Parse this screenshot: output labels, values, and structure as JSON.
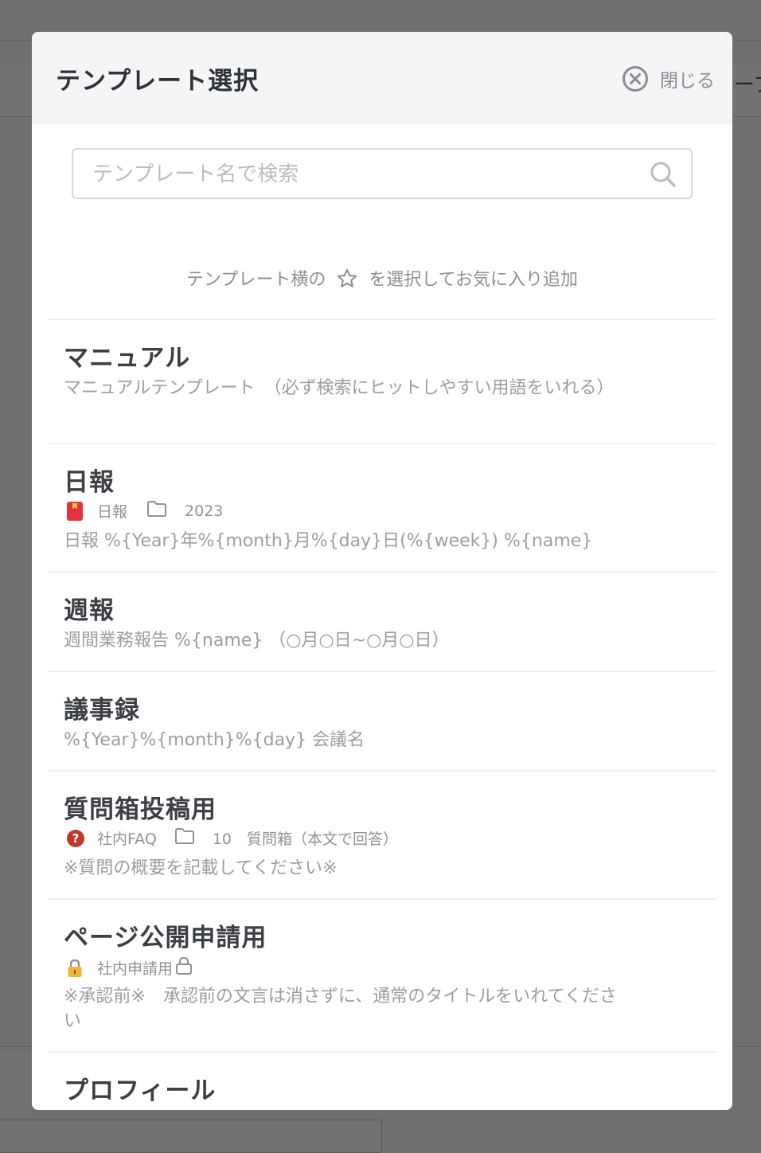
{
  "background": {
    "right_edge_text": "ーブ"
  },
  "modal": {
    "title": "テンプレート選択",
    "close_label": "閉じる",
    "search_placeholder": "テンプレート名で検索",
    "hint_before": "テンプレート横の",
    "hint_after": "を選択してお気に入り追加"
  },
  "templates": [
    {
      "title": "マニュアル",
      "description": "マニュアルテンプレート　（必ず検索にヒットしやすい用語をいれる）"
    },
    {
      "title": "日報",
      "category": "日報",
      "folder": "2023",
      "description": "日報 %{Year}年%{month}月%{day}日(%{week}) %{name}"
    },
    {
      "title": "週報",
      "description": "週間業務報告 %{name} （○月○日~○月○日）"
    },
    {
      "title": "議事録",
      "description": "%{Year}%{month}%{day} 会議名"
    },
    {
      "title": "質問箱投稿用",
      "category": "社内FAQ",
      "folder": "10　質問箱（本文で回答）",
      "description": "※質問の概要を記載してください※"
    },
    {
      "title": "ページ公開申請用",
      "category": "社内申請用",
      "description": "※承認前※　承認前の文言は消さずに、通常のタイトルをいれてください"
    },
    {
      "title": "プロフィール"
    }
  ]
}
